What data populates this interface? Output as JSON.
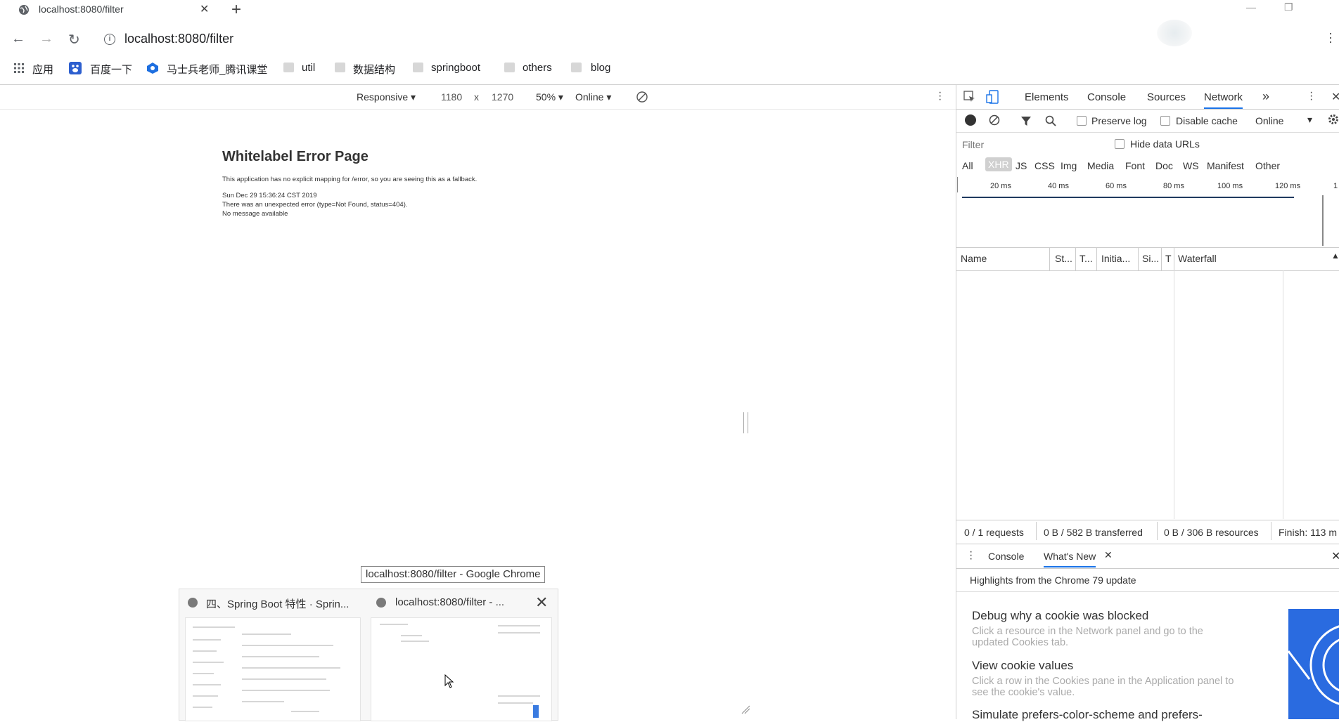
{
  "browser": {
    "tab": {
      "title": "localhost:8080/filter",
      "close": "✕"
    },
    "new_tab": "+",
    "window_controls": {
      "minimize": "—",
      "restore": "❐"
    },
    "nav": {
      "back": "←",
      "forward": "→",
      "reload": "↻"
    },
    "url": "localhost:8080/filter",
    "bookmarks": [
      {
        "label": "应用",
        "icon": "apps-grid-icon"
      },
      {
        "label": "百度一下",
        "icon": "baidu-icon"
      },
      {
        "label": "马士兵老师_腾讯课堂",
        "icon": "tencent-classroom-icon"
      },
      {
        "label": "util",
        "icon": "folder-icon"
      },
      {
        "label": "数据结构",
        "icon": "folder-icon"
      },
      {
        "label": "springboot",
        "icon": "folder-icon"
      },
      {
        "label": "others",
        "icon": "folder-icon"
      },
      {
        "label": "blog",
        "icon": "folder-icon"
      }
    ]
  },
  "device_toolbar": {
    "mode": "Responsive",
    "width": "1180",
    "times": "x",
    "height": "1270",
    "zoom": "50%",
    "throttle": "Online"
  },
  "page": {
    "title": "Whitelabel Error Page",
    "lines": [
      "This application has no explicit mapping for /error, so you are seeing this as a fallback.",
      "Sun Dec 29 15:36:24 CST 2019",
      "There was an unexpected error (type=Not Found, status=404).",
      "No message available"
    ]
  },
  "taskbar_preview": {
    "tooltip": "localhost:8080/filter - Google Chrome",
    "windows": [
      {
        "title": "四、Spring Boot 特性 · Sprin..."
      },
      {
        "title": "localhost:8080/filter - ..."
      }
    ],
    "close": "✕"
  },
  "devtools": {
    "tabs": [
      "Elements",
      "Console",
      "Sources",
      "Network"
    ],
    "more": "»",
    "active_tab": "Network",
    "network_toolbar": {
      "preserve_log": "Preserve log",
      "disable_cache": "Disable cache",
      "throttle": "Online"
    },
    "filter_placeholder": "Filter",
    "hide_data_urls": "Hide data URLs",
    "types": [
      "All",
      "XHR",
      "JS",
      "CSS",
      "Img",
      "Media",
      "Font",
      "Doc",
      "WS",
      "Manifest",
      "Other"
    ],
    "active_type": "XHR",
    "timeline_ticks": [
      "20 ms",
      "40 ms",
      "60 ms",
      "80 ms",
      "100 ms",
      "120 ms",
      "1"
    ],
    "columns": [
      "Name",
      "St...",
      "T...",
      "Initia...",
      "Si...",
      "T",
      "Waterfall"
    ],
    "status": {
      "requests": "0 / 1 requests",
      "transferred": "0 B / 582 B transferred",
      "resources": "0 B / 306 B resources",
      "finish": "Finish: 113 m"
    },
    "drawer": {
      "tabs": [
        "Console",
        "What's New"
      ],
      "highlights": "Highlights from the Chrome 79 update",
      "items": [
        {
          "title": "Debug why a cookie was blocked",
          "desc": "Click a resource in the Network panel and go to the updated Cookies tab."
        },
        {
          "title": "View cookie values",
          "desc": "Click a row in the Cookies pane in the Application panel to see the cookie's value."
        },
        {
          "title": "Simulate prefers-color-scheme and prefers-"
        }
      ]
    }
  }
}
